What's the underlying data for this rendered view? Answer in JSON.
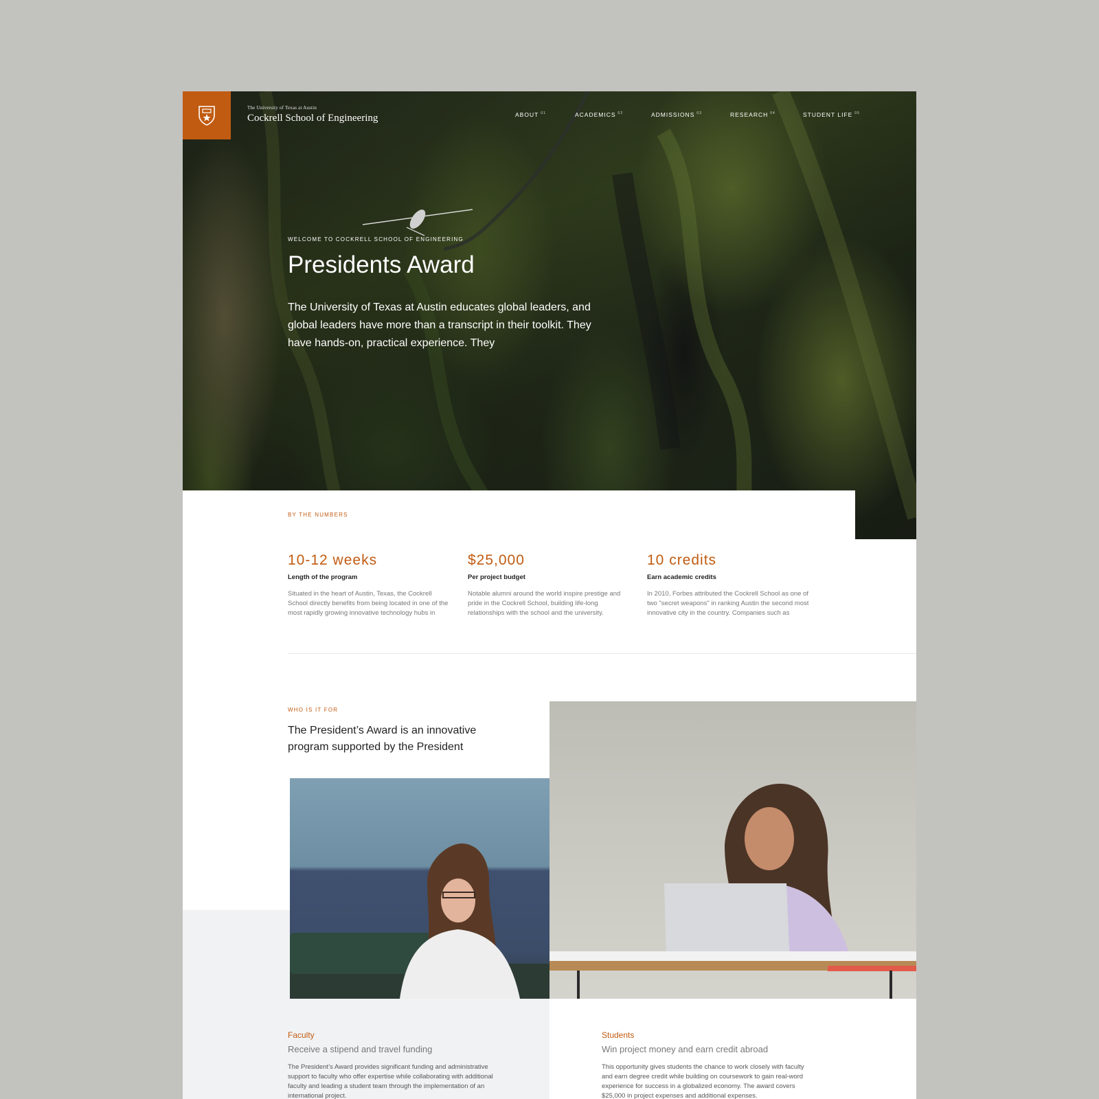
{
  "brand": {
    "university": "The University of Texas at Austin",
    "school": "Cockrell School of Engineering",
    "logo_icon": "shield-icon"
  },
  "nav": {
    "items": [
      {
        "label": "ABOUT",
        "num": "01"
      },
      {
        "label": "ACADEMICS",
        "num": "02"
      },
      {
        "label": "ADMISSIONS",
        "num": "03"
      },
      {
        "label": "RESEARCH",
        "num": "04"
      },
      {
        "label": "STUDENT LIFE",
        "num": "05"
      }
    ]
  },
  "hero": {
    "eyebrow": "WELCOME TO COCKRELL SCHOOL OF ENGINEERING",
    "title": "Presidents Award",
    "lead": "The University of Texas at Austin educates global leaders, and global leaders have more than a transcript in their toolkit. They have hands-on, practical experience. They"
  },
  "numbers": {
    "eyebrow": "BY THE NUMBERS",
    "stats": [
      {
        "value": "10-12 weeks",
        "label": "Length of the program",
        "desc": "Situated in the heart of Austin, Texas, the Cockrell School directly benefits from being located in one of the most rapidly growing innovative technology hubs in"
      },
      {
        "value": "$25,000",
        "label": "Per project budget",
        "desc": "Notable alumni around the world inspire prestige and pride in the Cockrell School, building life-long relationships with the school and the university."
      },
      {
        "value": "10 credits",
        "label": "Earn academic credits",
        "desc": "In 2010, Forbes attributed the Cockrell School as one of two \"secret weapons\" in ranking Austin the second most innovative city in the country. Companies such as"
      }
    ]
  },
  "who": {
    "eyebrow": "WHO IS IT FOR",
    "title": "The President’s Award is an innovative program supported by the President"
  },
  "cards": [
    {
      "kicker": "Faculty",
      "title": "Receive a stipend and travel funding",
      "body": "The President’s Award provides significant funding and administrative support to faculty who offer expertise while collaborating with additional faculty and leading a student team through the implementation of an international project."
    },
    {
      "kicker": "Students",
      "title": "Win project money and earn credit abroad",
      "body": "This opportunity gives students the chance to work closely with faculty and earn degree credit while building on coursework to gain real-word experience for success in a globalized economy. The award covers $25,000 in project expenses and additional expenses."
    }
  ],
  "colors": {
    "accent": "#c15b11",
    "band": "#f1f2f4"
  }
}
